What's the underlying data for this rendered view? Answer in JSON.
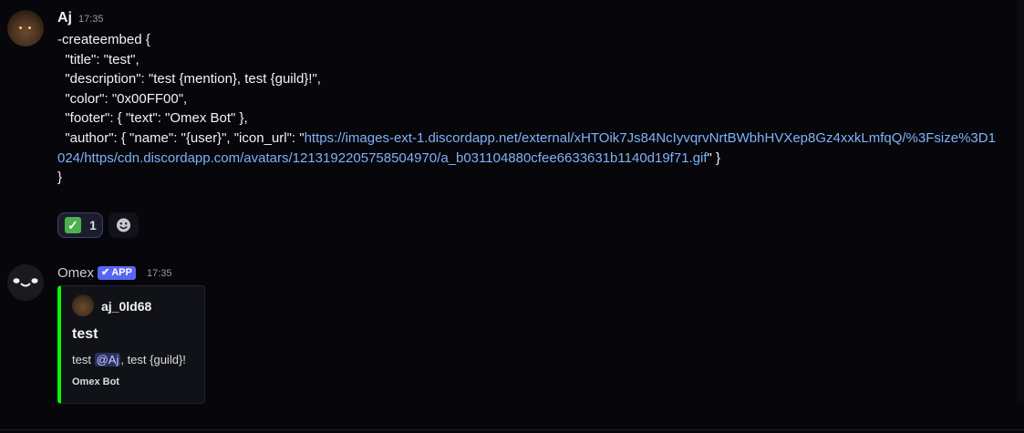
{
  "messages": [
    {
      "author": "Aj",
      "time": "17:35",
      "lines": [
        "-createembed {",
        "  \"title\": \"test\",",
        "  \"description\": \"test {mention}, test {guild}!\",",
        "  \"color\": \"0x00FF00\",",
        "  \"footer\": { \"text\": \"Omex Bot\" },"
      ],
      "author_line_prefix": "  \"author\": { \"name\": \"{user}\", \"icon_url\": \"",
      "link": "https://images-ext-1.discordapp.net/external/xHTOik7Js84NcIyvqrvNrtBWbhHVXep8Gz4xxkLmfqQ/%3Fsize%3D1024/https/cdn.discordapp.com/avatars/1213192205758504970/a_b031104880cfee6633631b1140d19f71.gif",
      "author_line_suffix": "\" }",
      "closing": "}",
      "reaction": {
        "emoji": "white-check-mark",
        "count": "1"
      }
    },
    {
      "author": "Omex",
      "badge": "APP",
      "time": "17:35",
      "embed": {
        "author": "aj_0ld68",
        "title": "test",
        "description_prefix": "test ",
        "mention": "@Aj",
        "description_suffix": ", test {guild}!",
        "footer": "Omex Bot",
        "color": "#00FF00"
      }
    }
  ],
  "colors": {
    "accent": "#5865f2",
    "link": "#7eb3f7",
    "embed_bar": "#00ff00"
  }
}
